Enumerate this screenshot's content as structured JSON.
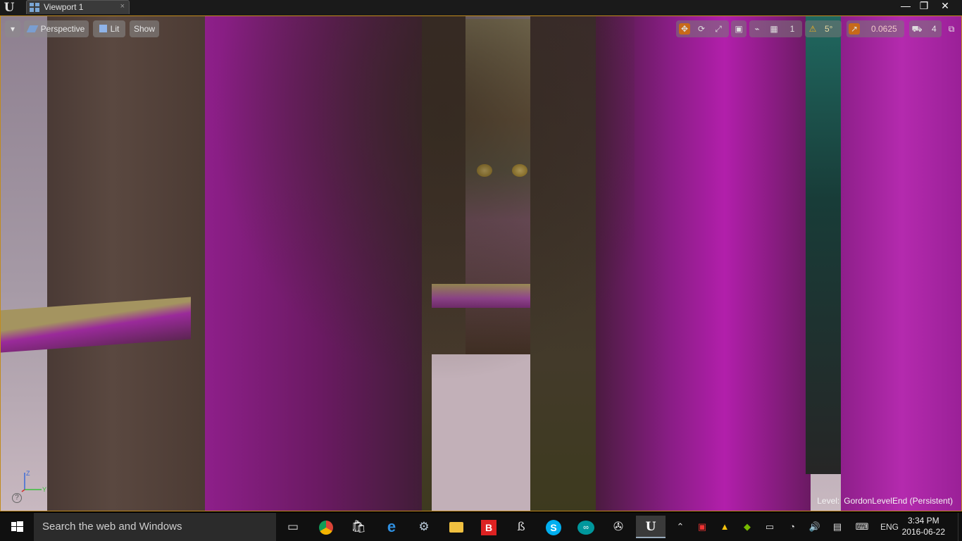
{
  "window": {
    "tab_label": "Viewport 1",
    "close_tab_glyph": "×",
    "minimize_glyph": "—",
    "maximize_glyph": "❐",
    "close_glyph": "✕"
  },
  "viewport_toolbar": {
    "menu_glyph": "▾",
    "perspective_label": "Perspective",
    "lit_label": "Lit",
    "show_label": "Show",
    "rotation_snap": "5°",
    "scale_snap": "0.0625",
    "camera_speed": "4",
    "grid_snap": "1"
  },
  "axis": {
    "z": "Z",
    "y": "Y"
  },
  "status": {
    "level_key": "Level:",
    "level_value": "GordonLevelEnd (Persistent)"
  },
  "taskbar": {
    "search_placeholder": "Search the web and Windows",
    "language": "ENG",
    "time": "3:34 PM",
    "date": "2016-06-22"
  },
  "colors": {
    "accent": "#c28b1c",
    "magenta": "#b01ea8",
    "taskbar": "#101010"
  }
}
